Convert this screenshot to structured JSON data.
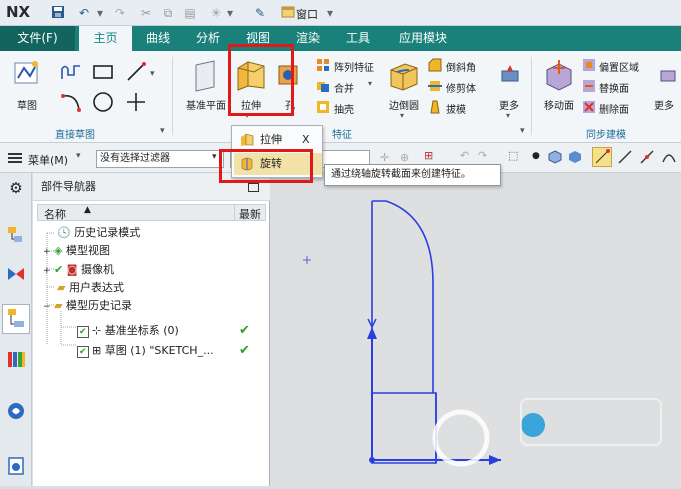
{
  "app": {
    "logo": "NX",
    "window_menu": "窗口"
  },
  "menu_tabs": [
    "文件(F)",
    "主页",
    "曲线",
    "分析",
    "视图",
    "渲染",
    "工具",
    "应用模块"
  ],
  "ribbon": {
    "groups": [
      "直接草图",
      "特征",
      "同步建模"
    ],
    "sketch_label": "草图",
    "datum_plane_label": "基准平面",
    "extrude_label": "拉伸",
    "hole_label": "孔",
    "pattern_feature": "阵列特征",
    "unite": "合并",
    "shell": "抽壳",
    "edge_blend_label": "边倒圆",
    "chamfer": "倒斜角",
    "trim_body": "修剪体",
    "draft": "拔模",
    "more_label": "更多",
    "move_face_label": "移动面",
    "offset_region": "偏置区域",
    "replace_face": "替换面",
    "delete_face": "删除面",
    "more_label_2": "更多"
  },
  "toolbar2": {
    "menu_label": "菜单(M)",
    "filter_label": "没有选择过滤器"
  },
  "navigator": {
    "title": "部件导航器",
    "col_name": "名称",
    "col_latest": "最新",
    "items": [
      {
        "label": "历史记录模式"
      },
      {
        "label": "模型视图"
      },
      {
        "label": "摄像机"
      },
      {
        "label": "用户表达式"
      },
      {
        "label": "模型历史记录"
      },
      {
        "label": "基准坐标系 (0)"
      },
      {
        "label": "草图 (1) \"SKETCH_..."
      }
    ]
  },
  "dropdown": {
    "item1": "拉伸",
    "item2": "旋转",
    "close": "X"
  },
  "tooltip": "通过绕轴旋转截面来创建特征。",
  "colors": {
    "accent": "#19817a",
    "highlight": "#e01a1a",
    "sketch": "#2b3fe0"
  }
}
